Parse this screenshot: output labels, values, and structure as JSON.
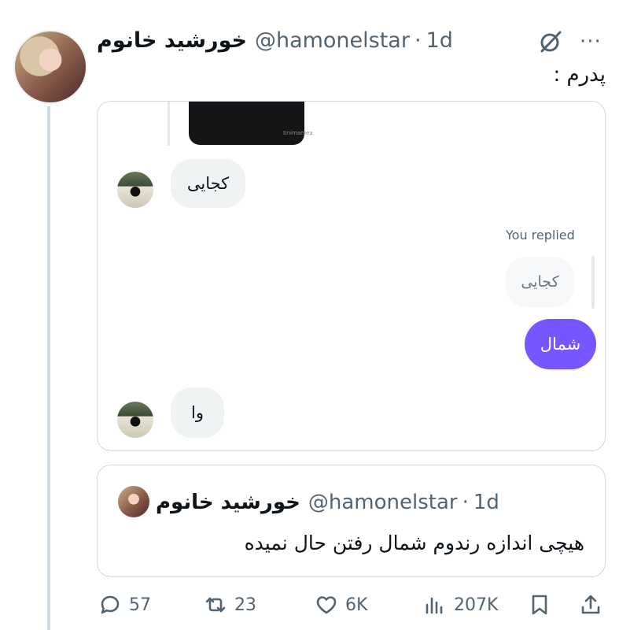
{
  "tweet": {
    "display_name": "خورشید خانوم",
    "handle": "@hamonelstar",
    "separator": "·",
    "time": "1d",
    "text": "پدرم :",
    "more_label": "···"
  },
  "dm_screenshot": {
    "message_in_1": "کجایی",
    "you_replied_label": "You replied",
    "replied_to": "کجایی",
    "message_out": "شمال",
    "message_in_2": "وا",
    "photo_watermark": "tinimamea"
  },
  "quote": {
    "display_name": "خورشید خانوم",
    "handle": "@hamonelstar",
    "separator": "·",
    "time": "1d",
    "text": "هیچی اندازه رندوم شمال رفتن حال نمیده"
  },
  "actions": {
    "replies": "57",
    "reposts": "23",
    "likes": "6K",
    "views": "207K"
  },
  "colors": {
    "accent_purple": "#7856ff",
    "secondary_text": "#536471",
    "border": "#cfd9de",
    "incoming_bubble": "#eff3f4"
  }
}
